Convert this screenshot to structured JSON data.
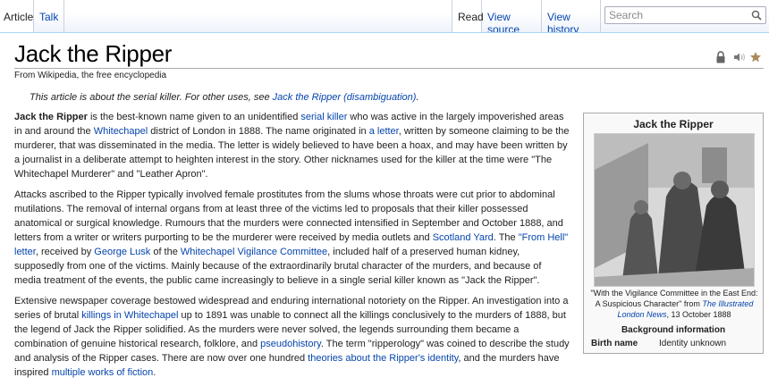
{
  "tabs": {
    "article": "Article",
    "talk": "Talk",
    "read": "Read",
    "view_source": "View source",
    "view_history": "View history"
  },
  "search": {
    "placeholder": "Search"
  },
  "page": {
    "title": "Jack the Ripper",
    "tagline": "From Wikipedia, the free encyclopedia",
    "hatnote": {
      "prefix": "This article is about the serial killer. For other uses, see ",
      "link": "Jack the Ripper (disambiguation)",
      "suffix": "."
    }
  },
  "paragraphs": [
    [
      {
        "t": "Jack the Ripper",
        "b": true
      },
      {
        "t": " is the best-known name given to an unidentified "
      },
      {
        "t": "serial killer",
        "l": true
      },
      {
        "t": " who was active in the largely impoverished areas in and around the "
      },
      {
        "t": "Whitechapel",
        "l": true
      },
      {
        "t": " district of London in 1888. The name originated in "
      },
      {
        "t": "a letter",
        "l": true
      },
      {
        "t": ", written by someone claiming to be the murderer, that was disseminated in the media. The letter is widely believed to have been a hoax, and may have been written by a journalist in a deliberate attempt to heighten interest in the story. Other nicknames used for the killer at the time were \"The Whitechapel Murderer\" and \"Leather Apron\"."
      }
    ],
    [
      {
        "t": "Attacks ascribed to the Ripper typically involved female prostitutes from the slums whose throats were cut prior to abdominal mutilations. The removal of internal organs from at least three of the victims led to proposals that their killer possessed anatomical or surgical knowledge. Rumours that the murders were connected intensified in September and October 1888, and letters from a writer or writers purporting to be the murderer were received by media outlets and "
      },
      {
        "t": "Scotland Yard",
        "l": true
      },
      {
        "t": ". The "
      },
      {
        "t": "\"From Hell\" letter",
        "l": true
      },
      {
        "t": ", received by "
      },
      {
        "t": "George Lusk",
        "l": true
      },
      {
        "t": " of the "
      },
      {
        "t": "Whitechapel Vigilance Committee",
        "l": true
      },
      {
        "t": ", included half of a preserved human kidney, supposedly from one of the victims. Mainly because of the extraordinarily brutal character of the murders, and because of media treatment of the events, the public came increasingly to believe in a single serial killer known as \"Jack the Ripper\"."
      }
    ],
    [
      {
        "t": "Extensive newspaper coverage bestowed widespread and enduring international notoriety on the Ripper. An investigation into a series of brutal "
      },
      {
        "t": "killings in Whitechapel",
        "l": true
      },
      {
        "t": " up to 1891 was unable to connect all the killings conclusively to the murders of 1888, but the legend of Jack the Ripper solidified. As the murders were never solved, the legends surrounding them became a combination of genuine historical research, folklore, and "
      },
      {
        "t": "pseudohistory",
        "l": true
      },
      {
        "t": ". The term \"ripperology\" was coined to describe the study and analysis of the Ripper cases. There are now over one hundred "
      },
      {
        "t": "theories about the Ripper's identity",
        "l": true
      },
      {
        "t": ", and the murders have inspired "
      },
      {
        "t": "multiple works of fiction",
        "l": true
      },
      {
        "t": "."
      }
    ]
  ],
  "infobox": {
    "title": "Jack the Ripper",
    "caption_prefix": "\"With the Vigilance Committee in the East End: A Suspicious Character\" from ",
    "caption_link": "The Illustrated London News",
    "caption_suffix": ", 13 October 1888",
    "background_heading": "Background information",
    "rows": [
      {
        "label": "Birth name",
        "value": "Identity unknown"
      }
    ]
  }
}
